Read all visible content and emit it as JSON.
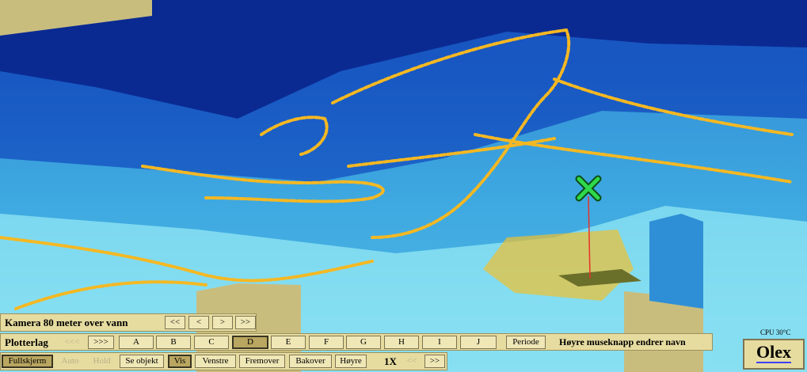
{
  "camera": {
    "label": "Kamera 80 meter over vann",
    "buttons": [
      "<<",
      "<",
      ">",
      ">>"
    ]
  },
  "plotter": {
    "label": "Plotterlag",
    "prev": "<<<",
    "next": ">>>",
    "layers": [
      "A",
      "B",
      "C",
      "D",
      "E",
      "F",
      "G",
      "H",
      "I",
      "J"
    ],
    "selected": "D",
    "period": "Periode",
    "hint": "Høyre museknapp endrer navn"
  },
  "toolbar": {
    "fullscreen": "Fullskjerm",
    "auto": "Auto",
    "hold": "Hold",
    "see_object": "Se objekt",
    "show": "Vis",
    "left": "Venstre",
    "forward": "Fremover",
    "backward": "Bakover",
    "right": "Høyre",
    "speed": "1X",
    "slower": "<<",
    "faster": ">>"
  },
  "status": {
    "cpu": "CPU 30°C"
  },
  "brand": {
    "logo": "Olex"
  },
  "colors": {
    "deep": "#0a2f9e",
    "mid": "#1f78d0",
    "shallow": "#6fd0ea",
    "track": "#f5b822",
    "panel": "#e6dca0",
    "marker": "#2ed84a"
  }
}
